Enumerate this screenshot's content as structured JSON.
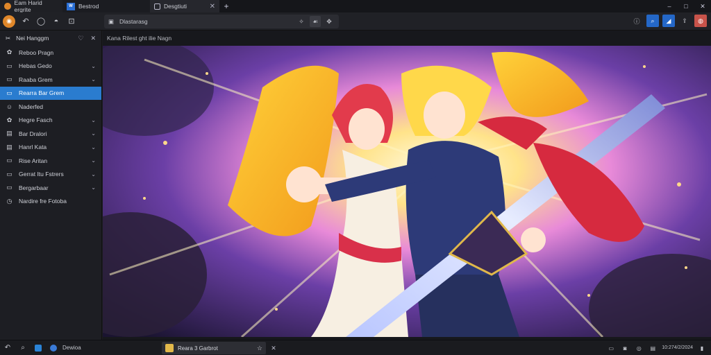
{
  "tabs": [
    {
      "label": "Eam Harid ergrite",
      "icon": "app-orange-icon"
    },
    {
      "label": "Bestrod",
      "icon": "app-blue-icon"
    },
    {
      "label": "Desgtiuti",
      "icon": "lock-icon"
    }
  ],
  "window_controls": {
    "minimize": "–",
    "maximize": "□",
    "close": "✕"
  },
  "address_bar": {
    "text": "Dlastarasg"
  },
  "sidebar": {
    "header": "Nei Hanggm",
    "items": [
      {
        "label": "Reboo Pragn",
        "icon": "gear-icon",
        "chevron": false
      },
      {
        "label": "Hebas Gedo",
        "icon": "folder-icon",
        "chevron": true
      },
      {
        "label": "Raaba Grem",
        "icon": "folder-icon",
        "chevron": true
      },
      {
        "label": "Rearra Bar Grem",
        "icon": "folder-icon",
        "chevron": false,
        "selected": true
      },
      {
        "label": "Naderfed",
        "icon": "smile-icon",
        "chevron": false
      },
      {
        "label": "Hegre Fasch",
        "icon": "gear-icon",
        "chevron": true
      },
      {
        "label": "Bar Dralori",
        "icon": "document-icon",
        "chevron": true
      },
      {
        "label": "Hanrl Kata",
        "icon": "document-icon",
        "chevron": true
      },
      {
        "label": "Rise Aritan",
        "icon": "folder-icon",
        "chevron": true
      },
      {
        "label": "Gerrat Itu Fstrers",
        "icon": "folder-icon",
        "chevron": true
      },
      {
        "label": "Bergarbaar",
        "icon": "folder-icon",
        "chevron": true
      },
      {
        "label": "Nardire fre Fotoba",
        "icon": "clock-icon",
        "chevron": false
      }
    ]
  },
  "content": {
    "title": "Kana Rilest ght ilie Nagn"
  },
  "taskbar": {
    "app_label": "Dewioa",
    "task_label": "Reara 3 Garbrot",
    "clock_time": "10:27",
    "clock_date": "4/2/2024"
  },
  "colors": {
    "accent": "#2a7ccf",
    "brand_orange": "#e0872a",
    "sidebar_bg": "#1d1e23",
    "toolbar_bg": "#202126"
  }
}
